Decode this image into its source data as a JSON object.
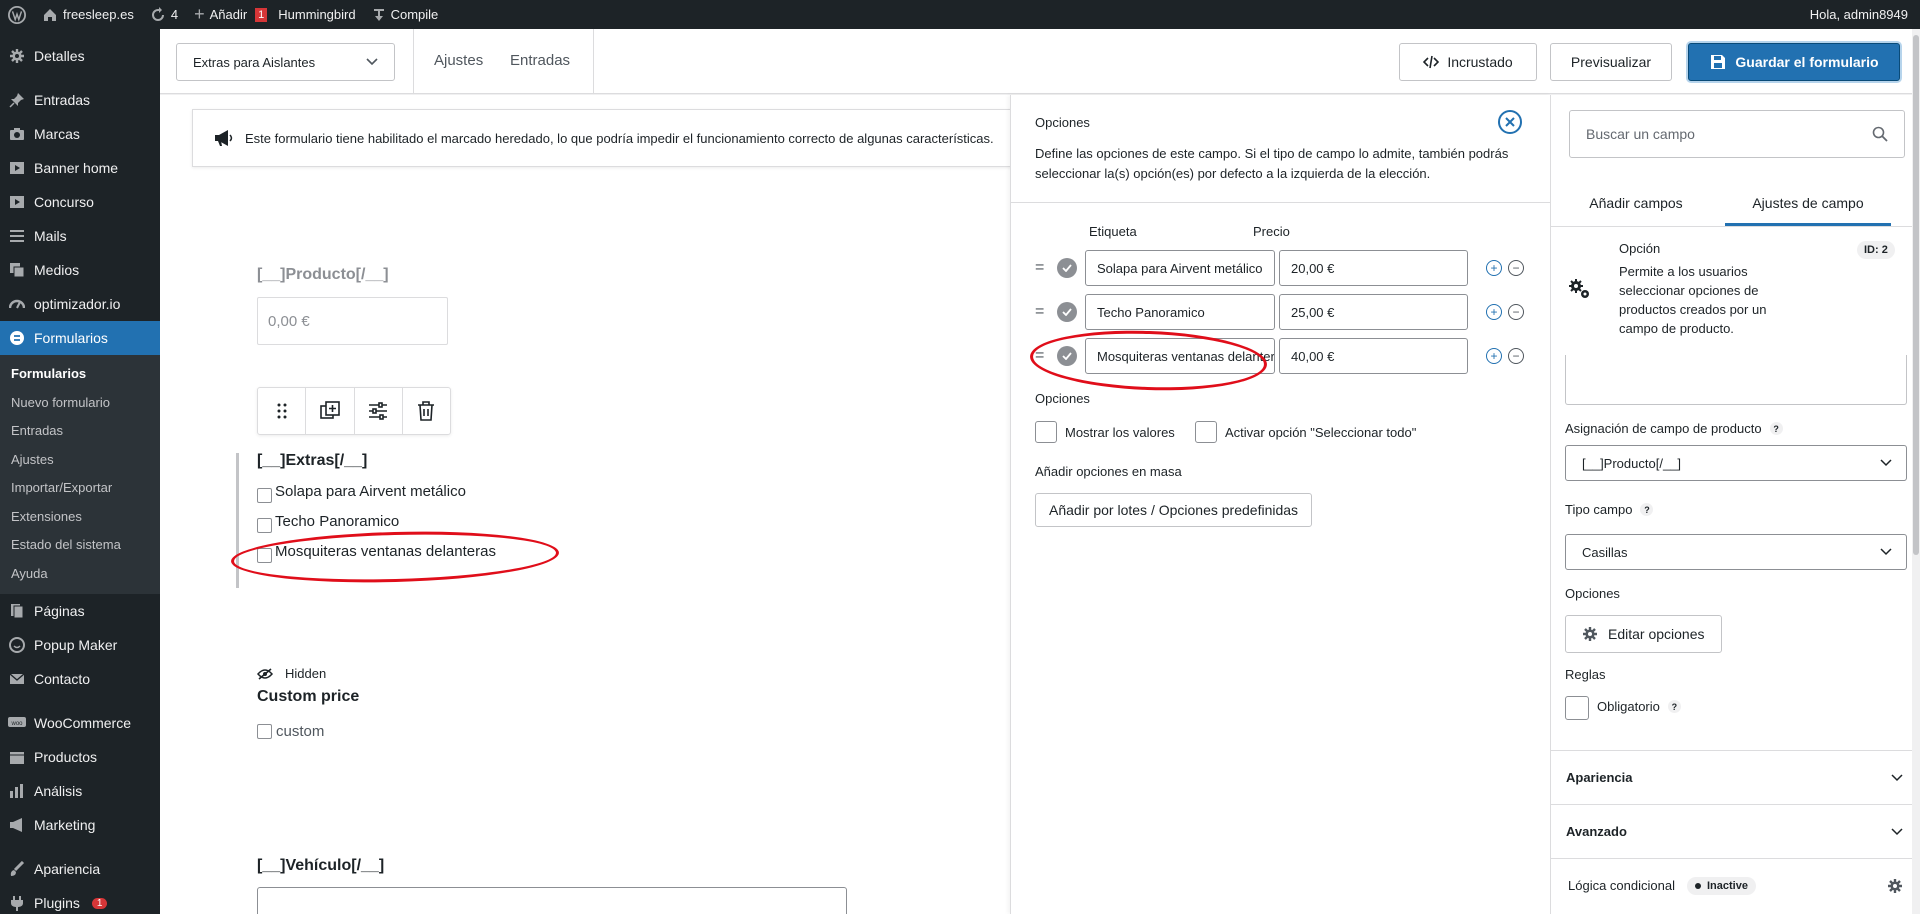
{
  "adminbar": {
    "site": "freesleep.es",
    "updates": "4",
    "add": "Añadir",
    "plugin_count": "1",
    "hummingbird": "Hummingbird",
    "compile": "Compile",
    "greeting": "Hola, admin8949"
  },
  "sidebar": {
    "items": [
      {
        "label": "Detalles",
        "icon": "gear-icon"
      },
      {
        "label": "Entradas",
        "icon": "pin-icon"
      },
      {
        "label": "Marcas",
        "icon": "camera-icon"
      },
      {
        "label": "Banner home",
        "icon": "video-icon"
      },
      {
        "label": "Concurso",
        "icon": "video-icon"
      },
      {
        "label": "Mails",
        "icon": "menu-icon"
      },
      {
        "label": "Medios",
        "icon": "media-icon"
      },
      {
        "label": "optimizador.io",
        "icon": "speed-icon"
      },
      {
        "label": "Formularios",
        "icon": "forms-icon"
      }
    ],
    "sub": [
      "Formularios",
      "Nuevo formulario",
      "Entradas",
      "Ajustes",
      "Importar/Exportar",
      "Extensiones",
      "Estado del sistema",
      "Ayuda"
    ],
    "items2": [
      {
        "label": "Páginas",
        "icon": "page-icon"
      },
      {
        "label": "Popup Maker",
        "icon": "popup-icon"
      },
      {
        "label": "Contacto",
        "icon": "mail-icon"
      },
      {
        "label": "WooCommerce",
        "icon": "woo-icon"
      },
      {
        "label": "Productos",
        "icon": "box-icon"
      },
      {
        "label": "Análisis",
        "icon": "chart-icon"
      },
      {
        "label": "Marketing",
        "icon": "megaphone-icon"
      },
      {
        "label": "Apariencia",
        "icon": "brush-icon"
      },
      {
        "label": "Plugins",
        "icon": "plugin-icon",
        "badge": "1"
      }
    ]
  },
  "topbar": {
    "form_select": "Extras para Aislantes",
    "tab_ajustes": "Ajustes",
    "tab_entradas": "Entradas",
    "embed": "Incrustado",
    "preview": "Previsualizar",
    "save": "Guardar el formulario"
  },
  "notice": "Este formulario tiene habilitado el marcado heredado, lo que podría impedir el funcionamiento correcto de algunas características.",
  "canvas": {
    "producto_label": "[__]Producto[/__]",
    "producto_placeholder": "0,00 €",
    "extras_label": "[__]Extras[/__]",
    "extras_options": [
      "Solapa para Airvent metálico",
      "Techo Panoramico",
      "Mosquiteras ventanas delanteras"
    ],
    "hidden": "Hidden",
    "custom_label": "Custom price",
    "custom_option": "custom",
    "vehiculo_label": "[__]Vehículo[/__]"
  },
  "options_panel": {
    "title": "Opciones",
    "desc": "Define las opciones de este campo. Si el tipo de campo lo admite, también podrás seleccionar la(s) opción(es) por defecto a la izquierda de la elección.",
    "col_label": "Etiqueta",
    "col_price": "Precio",
    "rows": [
      {
        "label": "Solapa para Airvent metálico",
        "price": "20,00 €"
      },
      {
        "label": "Techo Panoramico",
        "price": "25,00 €"
      },
      {
        "label": "Mosquiteras ventanas delanteras",
        "price": "40,00 €"
      }
    ],
    "opciones": "Opciones",
    "show_values": "Mostrar los valores",
    "select_all": "Activar opción \"Seleccionar todo\"",
    "bulk_title": "Añadir opciones en masa",
    "bulk_button": "Añadir por lotes / Opciones predefinidas"
  },
  "right": {
    "search_placeholder": "Buscar un campo",
    "tab_add": "Añadir campos",
    "tab_settings": "Ajustes de campo",
    "field_name": "Opción",
    "field_id": "ID: 2",
    "field_desc": "Permite a los usuarios seleccionar opciones de productos creados por un campo de producto.",
    "assign_label": "Asignación de campo de producto",
    "assign_value": "[__]Producto[/__]",
    "type_label": "Tipo campo",
    "type_value": "Casillas",
    "options_label": "Opciones",
    "edit_options": "Editar opciones",
    "rules_label": "Reglas",
    "required": "Obligatorio",
    "appearance": "Apariencia",
    "advanced": "Avanzado",
    "logic": "Lógica condicional",
    "logic_status": "Inactive"
  },
  "colors": {
    "accent": "#2271b1",
    "admin_dark": "#1d2327",
    "annotation": "#e00e1a"
  }
}
